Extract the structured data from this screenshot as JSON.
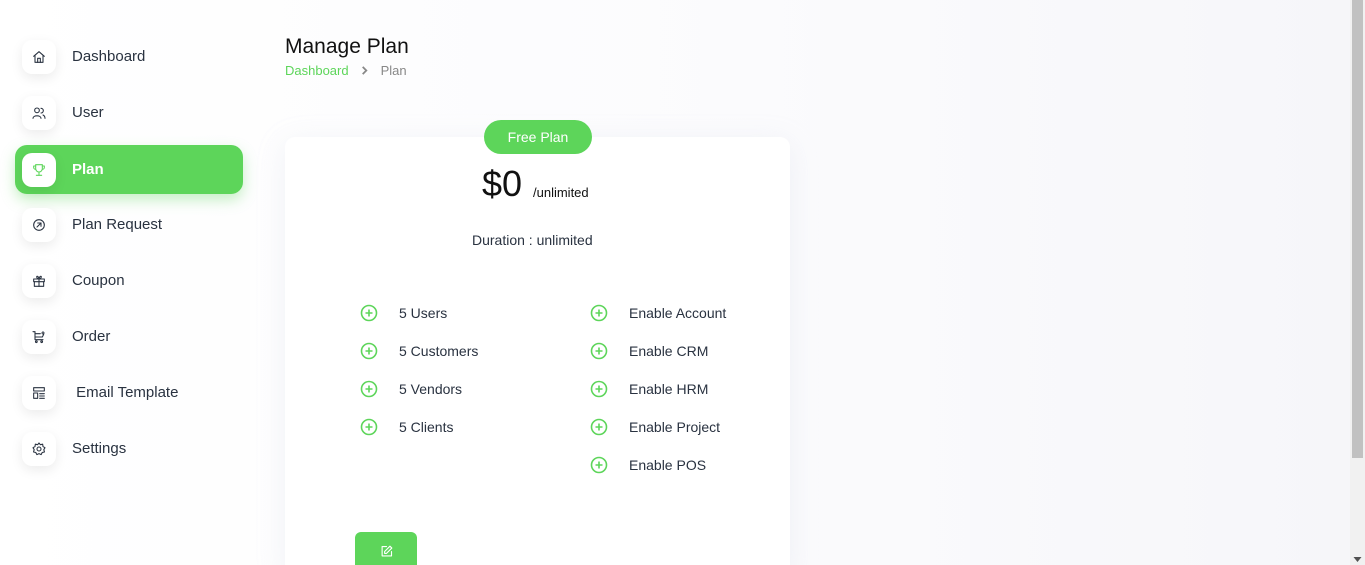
{
  "sidebar": {
    "items": [
      {
        "label": "Dashboard",
        "icon": "home-icon"
      },
      {
        "label": "User",
        "icon": "users-icon"
      },
      {
        "label": "Plan",
        "icon": "trophy-icon",
        "active": true
      },
      {
        "label": "Plan Request",
        "icon": "arrow-up-right-circle-icon"
      },
      {
        "label": "Coupon",
        "icon": "gift-icon"
      },
      {
        "label": "Order",
        "icon": "cart-icon"
      },
      {
        "label": " Email Template",
        "icon": "template-icon"
      },
      {
        "label": "Settings",
        "icon": "gear-icon"
      }
    ]
  },
  "header": {
    "title": "Manage Plan",
    "breadcrumb": {
      "link": "Dashboard",
      "current": "Plan"
    }
  },
  "plan": {
    "name": "Free Plan",
    "price": "$0",
    "period": "/unlimited",
    "duration_label": "Duration : ",
    "duration_value": "unlimited",
    "limits": [
      "5 Users",
      "5 Customers",
      "5 Vendors",
      "5 Clients"
    ],
    "modules": [
      "Enable Account",
      "Enable CRM",
      "Enable HRM",
      "Enable Project",
      "Enable POS"
    ]
  },
  "colors": {
    "accent": "#5dd55a",
    "text": "#293240",
    "muted": "#888888"
  }
}
